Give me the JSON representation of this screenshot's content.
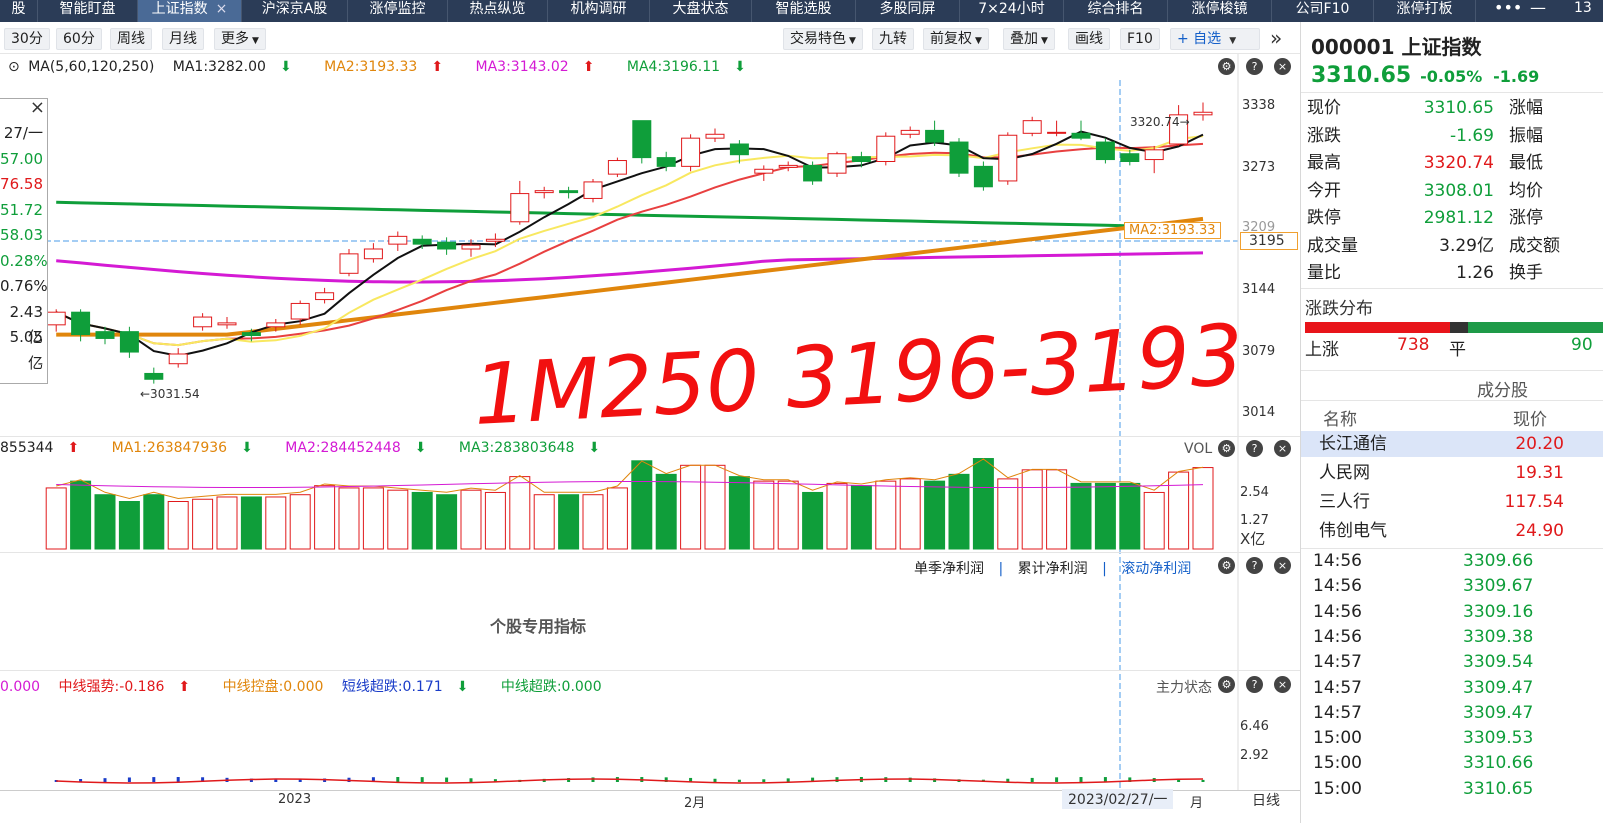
{
  "nav": {
    "tabs": [
      "股",
      "智能盯盘",
      "上证指数",
      "沪深京A股",
      "涨停监控",
      "热点纵览",
      "机构调研",
      "大盘状态",
      "智能选股",
      "多股同屏",
      "7×24小时",
      "综合排名",
      "涨停梭镜",
      "公司F10",
      "涨停打板"
    ],
    "active_index": 2,
    "close_glyph": "×",
    "more": "•••",
    "minimize": "—",
    "tail": "13"
  },
  "toolbar": {
    "periods": [
      "30分",
      "60分",
      "周线",
      "月线",
      "更多"
    ],
    "right": [
      "交易特色",
      "九转",
      "前复权",
      "叠加",
      "画线",
      "F10"
    ],
    "add_watch": "+ 自选",
    "collapse": "»"
  },
  "main_chart": {
    "ma_label": "MA(5,60,120,250)",
    "ma1": "MA1:3282.00",
    "ma2": "MA2:3193.33",
    "ma3": "MA3:3143.02",
    "ma4": "MA4:3196.11",
    "y_ticks": [
      "3338",
      "3273",
      "3209",
      "3144",
      "3079",
      "3014"
    ],
    "crosshair_price": "3195",
    "ma2_tag": "MA2:3193.33",
    "high_marker": "3320.74→",
    "low_marker": "←3031.54",
    "handwriting": "1M250 3196-3193",
    "info_box": [
      "27/一",
      "57.00",
      "76.58",
      "51.72",
      "58.03",
      "0.28%",
      "0.76%",
      "2.43亿",
      "5.05亿",
      "-"
    ],
    "info_close": "×",
    "colors": {
      "up": "#e0191b",
      "down": "#0f9e3a",
      "ma1": "#111111",
      "ma2": "#e0860c",
      "ma3": "#d41ad4",
      "ma4": "#0f9e3a",
      "ma5": "#f8e860",
      "ma6": "#e84040"
    }
  },
  "chart_data": {
    "type": "candlestick",
    "title": "000001 上证指数",
    "y_range": [
      2990,
      3350
    ],
    "candles": [
      {
        "o": 3092,
        "c": 3105,
        "h": 3108,
        "l": 3085
      },
      {
        "o": 3105,
        "c": 3082,
        "h": 3108,
        "l": 3075
      },
      {
        "o": 3085,
        "c": 3078,
        "h": 3090,
        "l": 3072
      },
      {
        "o": 3085,
        "c": 3064,
        "h": 3090,
        "l": 3058
      },
      {
        "o": 3042,
        "c": 3036,
        "h": 3048,
        "l": 3031.54
      },
      {
        "o": 3052,
        "c": 3062,
        "h": 3068,
        "l": 3048
      },
      {
        "o": 3090,
        "c": 3100,
        "h": 3104,
        "l": 3086
      },
      {
        "o": 3092,
        "c": 3094,
        "h": 3100,
        "l": 3088
      },
      {
        "o": 3084,
        "c": 3081,
        "h": 3088,
        "l": 3075
      },
      {
        "o": 3090,
        "c": 3094,
        "h": 3098,
        "l": 3085
      },
      {
        "o": 3098,
        "c": 3114,
        "h": 3117,
        "l": 3092
      },
      {
        "o": 3118,
        "c": 3125,
        "h": 3130,
        "l": 3114
      },
      {
        "o": 3145,
        "c": 3165,
        "h": 3170,
        "l": 3142
      },
      {
        "o": 3160,
        "c": 3170,
        "h": 3176,
        "l": 3156
      },
      {
        "o": 3175,
        "c": 3183,
        "h": 3188,
        "l": 3168
      },
      {
        "o": 3180,
        "c": 3175,
        "h": 3184,
        "l": 3170
      },
      {
        "o": 3177,
        "c": 3170,
        "h": 3182,
        "l": 3164
      },
      {
        "o": 3170,
        "c": 3174,
        "h": 3180,
        "l": 3162
      },
      {
        "o": 3178,
        "c": 3180,
        "h": 3186,
        "l": 3172
      },
      {
        "o": 3198,
        "c": 3227,
        "h": 3240,
        "l": 3195
      },
      {
        "o": 3228,
        "c": 3230,
        "h": 3234,
        "l": 3222
      },
      {
        "o": 3230,
        "c": 3228,
        "h": 3234,
        "l": 3222
      },
      {
        "o": 3222,
        "c": 3239,
        "h": 3242,
        "l": 3218
      },
      {
        "o": 3247,
        "c": 3261,
        "h": 3264,
        "l": 3244
      },
      {
        "o": 3302,
        "c": 3264,
        "h": 3302,
        "l": 3258
      },
      {
        "o": 3264,
        "c": 3255,
        "h": 3270,
        "l": 3250
      },
      {
        "o": 3255,
        "c": 3284,
        "h": 3288,
        "l": 3250
      },
      {
        "o": 3284,
        "c": 3288,
        "h": 3294,
        "l": 3280
      },
      {
        "o": 3278,
        "c": 3267,
        "h": 3282,
        "l": 3258
      },
      {
        "o": 3248,
        "c": 3252,
        "h": 3256,
        "l": 3240
      },
      {
        "o": 3254,
        "c": 3256,
        "h": 3260,
        "l": 3250
      },
      {
        "o": 3256,
        "c": 3240,
        "h": 3260,
        "l": 3236
      },
      {
        "o": 3248,
        "c": 3268,
        "h": 3270,
        "l": 3244
      },
      {
        "o": 3265,
        "c": 3260,
        "h": 3270,
        "l": 3254
      },
      {
        "o": 3260,
        "c": 3286,
        "h": 3290,
        "l": 3256
      },
      {
        "o": 3288,
        "c": 3292,
        "h": 3296,
        "l": 3284
      },
      {
        "o": 3292,
        "c": 3280,
        "h": 3302,
        "l": 3276
      },
      {
        "o": 3280,
        "c": 3248,
        "h": 3284,
        "l": 3244
      },
      {
        "o": 3255,
        "c": 3234,
        "h": 3260,
        "l": 3230
      },
      {
        "o": 3240,
        "c": 3287,
        "h": 3290,
        "l": 3236
      },
      {
        "o": 3289,
        "c": 3302,
        "h": 3306,
        "l": 3286
      },
      {
        "o": 3289,
        "c": 3290,
        "h": 3302,
        "l": 3286
      },
      {
        "o": 3289,
        "c": 3284,
        "h": 3302,
        "l": 3282
      },
      {
        "o": 3280,
        "c": 3262,
        "h": 3284,
        "l": 3258
      },
      {
        "o": 3268,
        "c": 3260,
        "h": 3272,
        "l": 3256
      },
      {
        "o": 3262,
        "c": 3272,
        "h": 3276,
        "l": 3248
      },
      {
        "o": 3278,
        "c": 3308,
        "h": 3318,
        "l": 3276
      },
      {
        "o": 3308,
        "c": 3310.65,
        "h": 3320.74,
        "l": 3302
      }
    ],
    "volume_y_ticks": [
      "2.54",
      "1.27",
      "X亿"
    ]
  },
  "volume": {
    "head": "855344",
    "ma1": "MA1:263847936",
    "ma2": "MA2:284452448",
    "ma3": "MA3:283803648",
    "label": "VOL",
    "values": [
      2.7,
      3.0,
      2.4,
      2.1,
      2.4,
      2.1,
      2.2,
      2.3,
      2.3,
      2.3,
      2.4,
      2.8,
      2.7,
      2.7,
      2.6,
      2.5,
      2.4,
      2.6,
      2.5,
      3.2,
      2.4,
      2.4,
      2.4,
      2.7,
      3.9,
      3.3,
      3.7,
      3.7,
      3.2,
      3.0,
      3.0,
      2.5,
      2.9,
      2.8,
      3.0,
      3.1,
      3.0,
      3.3,
      4.0,
      3.1,
      3.5,
      3.5,
      2.9,
      2.9,
      2.9,
      2.5,
      3.4,
      3.6
    ]
  },
  "profit_panel": {
    "tabs": [
      "单季净利润",
      "累计净利润",
      "滚动净利润"
    ],
    "center": "个股专用指标"
  },
  "flow_panel": {
    "items": [
      "0.000",
      "中线强势:-0.186",
      "中线控盘:0.000",
      "短线超跌:0.171",
      "中线超跌:0.000"
    ],
    "label": "主力状态",
    "y_ticks": [
      "6.46",
      "2.92"
    ]
  },
  "x_axis": {
    "labels": [
      "2023",
      "2月"
    ],
    "cursor_date": "2023/02/27/一",
    "month_tail": "月",
    "period": "日线"
  },
  "quote": {
    "code": "000001",
    "name": "上证指数",
    "price": "3310.65",
    "chg_pct": "-0.05%",
    "chg": "-1.69",
    "rows": [
      {
        "k": "现价",
        "v": "3310.65",
        "k2": "涨幅",
        "color": "#0f9e3a"
      },
      {
        "k": "涨跌",
        "v": "-1.69",
        "k2": "振幅",
        "color": "#0f9e3a"
      },
      {
        "k": "最高",
        "v": "3320.74",
        "k2": "最低",
        "color": "#e0191b"
      },
      {
        "k": "今开",
        "v": "3308.01",
        "k2": "均价",
        "color": "#0f9e3a"
      },
      {
        "k": "跌停",
        "v": "2981.12",
        "k2": "涨停",
        "color": "#0f9e3a"
      },
      {
        "k": "成交量",
        "v": "3.29亿",
        "k2": "成交额",
        "color": "#222222"
      },
      {
        "k": "量比",
        "v": "1.26",
        "k2": "换手",
        "color": "#222222"
      }
    ],
    "distribution_title": "涨跌分布",
    "up_label": "上涨",
    "up_count": "738",
    "flat_label": "平",
    "down_count": "90",
    "constituents_title": "成分股",
    "col_name": "名称",
    "col_price": "现价",
    "constituents": [
      {
        "name": "长江通信",
        "price": "20.20"
      },
      {
        "name": "人民网",
        "price": "19.31"
      },
      {
        "name": "三人行",
        "price": "117.54"
      },
      {
        "name": "伟创电气",
        "price": "24.90"
      }
    ],
    "ticks": [
      {
        "t": "14:56",
        "p": "3309.66"
      },
      {
        "t": "14:56",
        "p": "3309.67"
      },
      {
        "t": "14:56",
        "p": "3309.16"
      },
      {
        "t": "14:56",
        "p": "3309.38"
      },
      {
        "t": "14:57",
        "p": "3309.54"
      },
      {
        "t": "14:57",
        "p": "3309.47"
      },
      {
        "t": "14:57",
        "p": "3309.47"
      },
      {
        "t": "15:00",
        "p": "3309.53"
      },
      {
        "t": "15:00",
        "p": "3310.66"
      },
      {
        "t": "15:00",
        "p": "3310.65"
      }
    ]
  }
}
